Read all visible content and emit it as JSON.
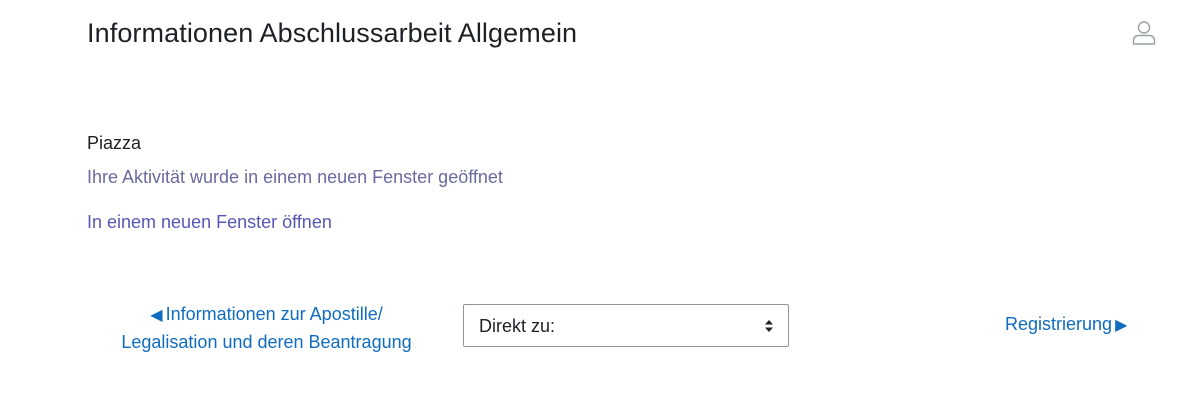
{
  "header": {
    "title": "Informationen Abschlussarbeit Allgemein",
    "user_icon": "user-icon"
  },
  "activity": {
    "name": "Piazza",
    "info": "Ihre Aktivität wurde in einem neuen Fenster geöffnet",
    "open_link": "In einem neuen Fenster öffnen"
  },
  "navigation": {
    "prev_line1": "Informationen zur Apostille/",
    "prev_line2": "Legalisation und deren Beantragung",
    "prev_icon": "triangle-left-icon",
    "jump_selected": "Direkt zu:",
    "jump_icon": "select-arrows-icon",
    "next_label": "Registrierung",
    "next_icon": "triangle-right-icon"
  },
  "colors": {
    "link": "#0f6cbf",
    "info_text": "#6a6a9f",
    "open_link": "#5757b5",
    "text": "#1d2125"
  }
}
